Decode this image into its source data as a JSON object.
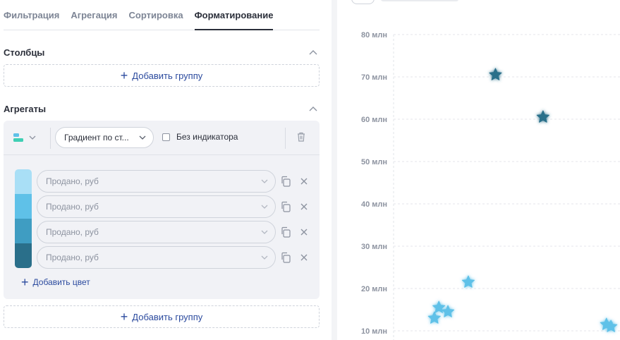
{
  "tabs": [
    {
      "label": "Фильтрация",
      "active": false
    },
    {
      "label": "Агрегация",
      "active": false
    },
    {
      "label": "Сортировка",
      "active": false
    },
    {
      "label": "Форматирование",
      "active": true
    }
  ],
  "columns": {
    "title": "Столбцы",
    "add_group_label": "Добавить группу"
  },
  "aggregates": {
    "title": "Агрегаты",
    "type_icon": "bar-type-icon",
    "gradient_select": "Градиент по ст...",
    "no_indicator_label": "Без индикатора",
    "no_indicator_checked": false,
    "color_swatches": [
      "#a9dff6",
      "#5fc1e8",
      "#3f9dc2",
      "#2a6f8a"
    ],
    "metrics": [
      {
        "placeholder": "Продано, руб"
      },
      {
        "placeholder": "Продано, руб"
      },
      {
        "placeholder": "Продано, руб"
      },
      {
        "placeholder": "Продано, руб"
      }
    ],
    "add_color_label": "Добавить цвет",
    "add_group_label": "Добавить группу"
  },
  "colors": {
    "accent": "#2b4a9e",
    "text": "#2b2f3a",
    "muted": "#7d8595",
    "panel_bg": "#f1f2f6"
  },
  "chart_data": {
    "type": "scatter",
    "marker": "star",
    "yticks": [
      {
        "value": 10,
        "label": "10 млн"
      },
      {
        "value": 20,
        "label": "20 млн"
      },
      {
        "value": 30,
        "label": "30 млн"
      },
      {
        "value": 40,
        "label": "40 млн"
      },
      {
        "value": 50,
        "label": "50 млн"
      },
      {
        "value": 60,
        "label": "60 млн"
      },
      {
        "value": 70,
        "label": "70 млн"
      },
      {
        "value": 80,
        "label": "80 млн"
      }
    ],
    "ylim": [
      10,
      80
    ],
    "grid": true,
    "points": [
      {
        "x": 0.45,
        "y": 70.5,
        "color": "#2a6f8a"
      },
      {
        "x": 0.66,
        "y": 60.5,
        "color": "#2a6f8a"
      },
      {
        "x": 0.33,
        "y": 21.5,
        "color": "#5fc1e8"
      },
      {
        "x": 0.2,
        "y": 15.5,
        "color": "#5fc1e8"
      },
      {
        "x": 0.24,
        "y": 14.5,
        "color": "#5fc1e8"
      },
      {
        "x": 0.18,
        "y": 13.0,
        "color": "#5fc1e8"
      },
      {
        "x": 0.94,
        "y": 11.5,
        "color": "#5fc1e8"
      },
      {
        "x": 0.96,
        "y": 11.0,
        "color": "#5fc1e8"
      }
    ]
  }
}
